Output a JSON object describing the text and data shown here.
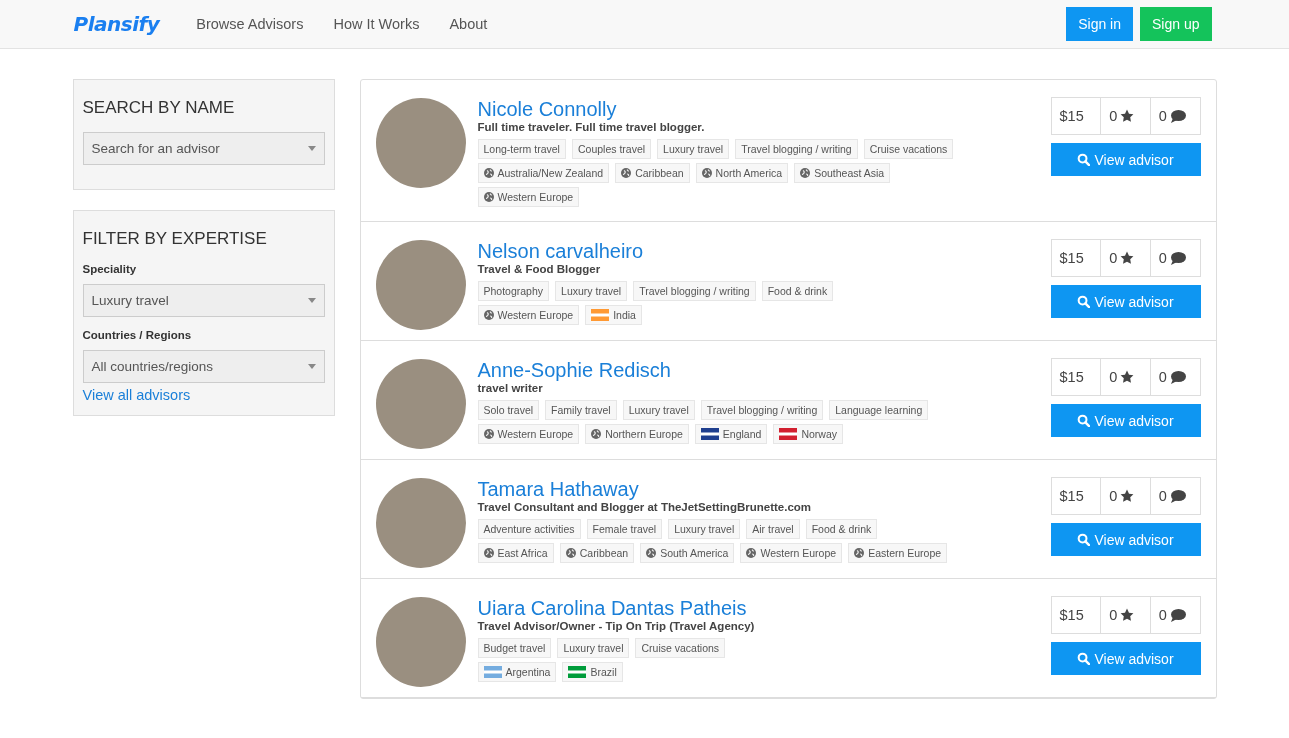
{
  "nav": {
    "logo": "Plansify",
    "links": [
      "Browse Advisors",
      "How It Works",
      "About"
    ],
    "sign_in": "Sign in",
    "sign_up": "Sign up"
  },
  "sidebar": {
    "search": {
      "title": "SEARCH BY NAME",
      "placeholder": "Search for an advisor"
    },
    "filter": {
      "title": "FILTER BY EXPERTISE",
      "speciality_label": "Speciality",
      "speciality_value": "Luxury travel",
      "regions_label": "Countries / Regions",
      "regions_value": "All countries/regions",
      "view_all": "View all advisors"
    }
  },
  "advisors": [
    {
      "name": "Nicole Connolly",
      "tagline": "Full time traveler. Full time travel blogger.",
      "tags": [
        "Long-term travel",
        "Couples travel",
        "Luxury travel",
        "Travel blogging / writing",
        "Cruise vacations"
      ],
      "regions": [
        {
          "label": "Australia/New Zealand",
          "kind": "region"
        },
        {
          "label": "Caribbean",
          "kind": "region"
        },
        {
          "label": "North America",
          "kind": "region"
        },
        {
          "label": "Southeast Asia",
          "kind": "region"
        },
        {
          "label": "Western Europe",
          "kind": "region"
        }
      ],
      "price": "$15",
      "stars": "0",
      "reviews": "0",
      "button": "View advisor"
    },
    {
      "name": "Nelson carvalheiro",
      "tagline": "Travel & Food Blogger",
      "tags": [
        "Photography",
        "Luxury travel",
        "Travel blogging / writing",
        "Food & drink"
      ],
      "regions": [
        {
          "label": "Western Europe",
          "kind": "region"
        },
        {
          "label": "India",
          "kind": "country",
          "color": "#ff9933"
        }
      ],
      "price": "$15",
      "stars": "0",
      "reviews": "0",
      "button": "View advisor"
    },
    {
      "name": "Anne-Sophie Redisch",
      "tagline": "travel writer",
      "tags": [
        "Solo travel",
        "Family travel",
        "Luxury travel",
        "Travel blogging / writing",
        "Language learning"
      ],
      "regions": [
        {
          "label": "Western Europe",
          "kind": "region"
        },
        {
          "label": "Northern Europe",
          "kind": "region"
        },
        {
          "label": "England",
          "kind": "country",
          "color": "#1f3f8f"
        },
        {
          "label": "Norway",
          "kind": "country",
          "color": "#d22030"
        }
      ],
      "price": "$15",
      "stars": "0",
      "reviews": "0",
      "button": "View advisor"
    },
    {
      "name": "Tamara Hathaway",
      "tagline": "Travel Consultant and Blogger at TheJetSettingBrunette.com",
      "tags": [
        "Adventure activities",
        "Female travel",
        "Luxury travel",
        "Air travel",
        "Food & drink"
      ],
      "regions": [
        {
          "label": "East Africa",
          "kind": "region"
        },
        {
          "label": "Caribbean",
          "kind": "region"
        },
        {
          "label": "South America",
          "kind": "region"
        },
        {
          "label": "Western Europe",
          "kind": "region"
        },
        {
          "label": "Eastern Europe",
          "kind": "region"
        }
      ],
      "price": "$15",
      "stars": "0",
      "reviews": "0",
      "button": "View advisor"
    },
    {
      "name": "Uiara Carolina Dantas Patheis",
      "tagline": "Travel Advisor/Owner - Tip On Trip (Travel Agency)",
      "tags": [
        "Budget travel",
        "Luxury travel",
        "Cruise vacations"
      ],
      "regions": [
        {
          "label": "Argentina",
          "kind": "country",
          "color": "#74acdf"
        },
        {
          "label": "Brazil",
          "kind": "country",
          "color": "#009c3b"
        }
      ],
      "price": "$15",
      "stars": "0",
      "reviews": "0",
      "button": "View advisor"
    }
  ]
}
